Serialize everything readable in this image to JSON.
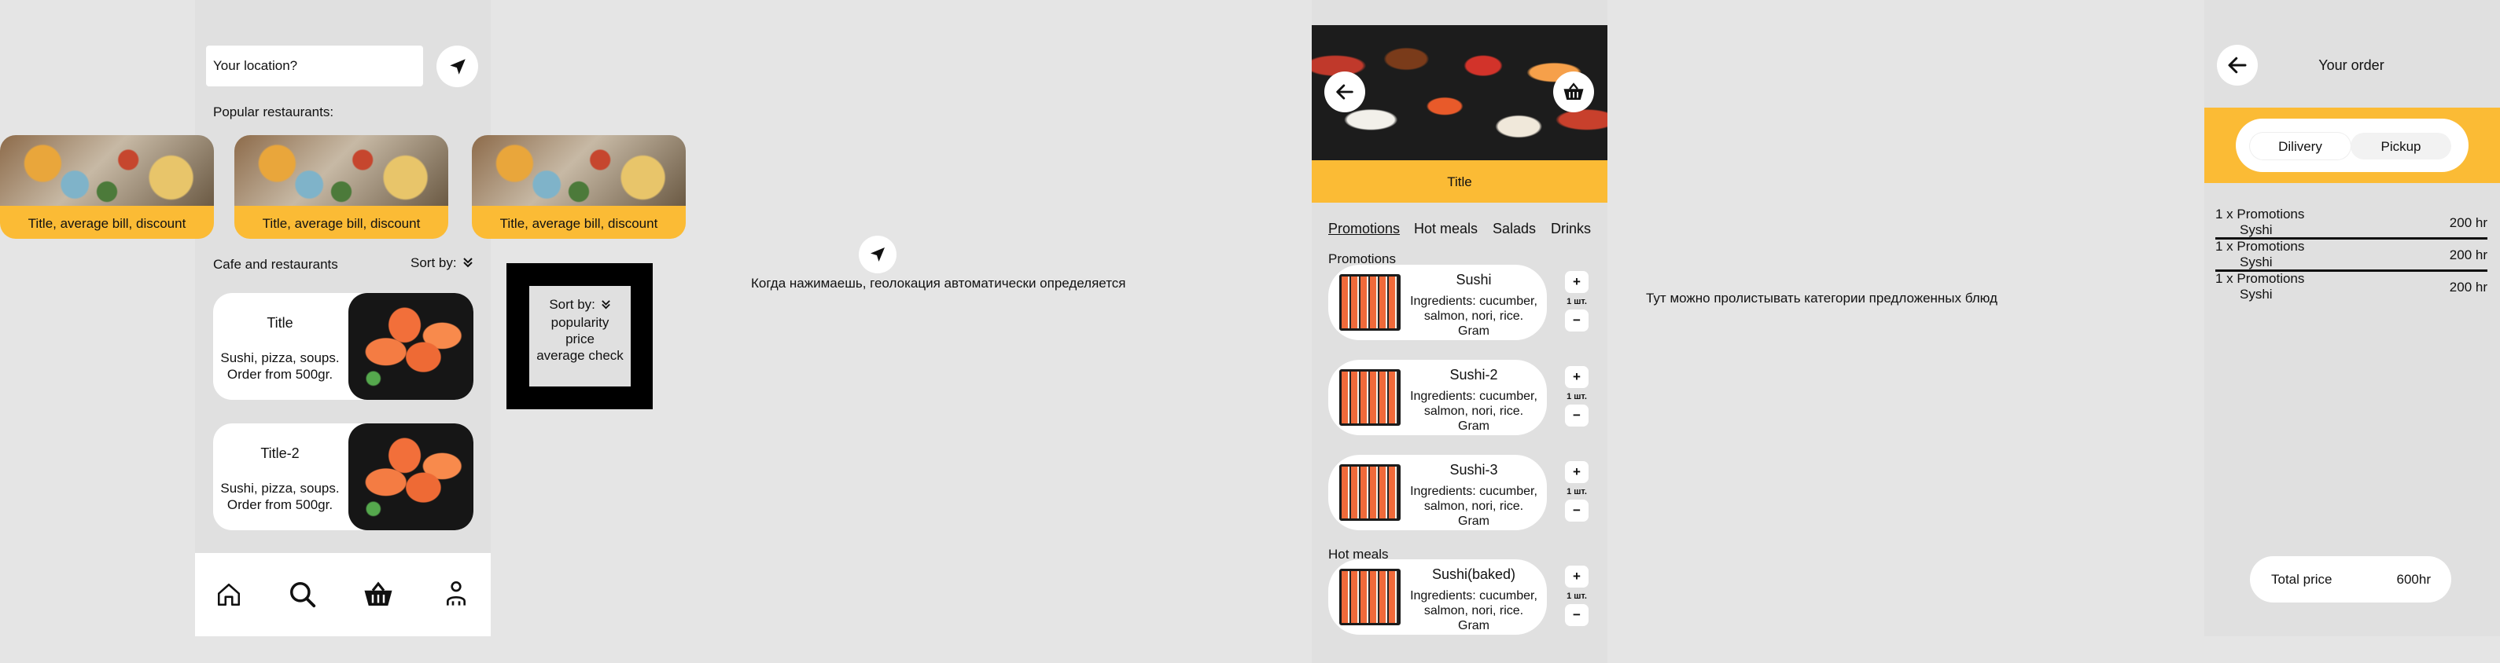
{
  "screen1": {
    "location_placeholder": "Your location?",
    "popular_label": "Popular restaurants:",
    "popular_cards": [
      {
        "caption": "Title, average bill, discount"
      },
      {
        "caption": "Title, average bill, discount"
      },
      {
        "caption": "Title, average bill, discount"
      }
    ],
    "cafes_label": "Cafe and restaurants",
    "sort_label": "Sort by:",
    "restaurants": [
      {
        "title": "Title",
        "desc": "Sushi, pizza, soups.\nOrder from 500gr."
      },
      {
        "title": "Title-2",
        "desc": "Sushi, pizza, soups.\nOrder from 500gr."
      }
    ],
    "nav": [
      "home-icon",
      "search-icon",
      "basket-icon",
      "profile-icon"
    ]
  },
  "sort_popup": {
    "title": "Sort by:",
    "options": [
      "popularity",
      "price",
      "average check"
    ]
  },
  "note_geo": "Когда нажимаешь, геолокация автоматически определяется",
  "screen2": {
    "title": "Title",
    "tabs": [
      "Promotions",
      "Hot meals",
      "Salads",
      "Drinks"
    ],
    "sections": [
      {
        "name": "Promotions",
        "items": [
          {
            "name": "Sushi",
            "desc": "Ingredients: cucumber,\nsalmon, nori, rice.\nGram",
            "qty": "1 шт."
          },
          {
            "name": "Sushi-2",
            "desc": "Ingredients: cucumber,\nsalmon, nori, rice.\nGram",
            "qty": "1 шт."
          },
          {
            "name": "Sushi-3",
            "desc": "Ingredients: cucumber,\nsalmon, nori, rice.\nGram",
            "qty": "1 шт."
          }
        ]
      },
      {
        "name": "Hot meals",
        "items": [
          {
            "name": "Sushi(baked)",
            "desc": "Ingredients: cucumber,\nsalmon, nori, rice.\nGram",
            "qty": "1 шт."
          }
        ]
      }
    ],
    "plus": "+",
    "minus": "−"
  },
  "note_scroll": "Тут можно пролистывать категории предложенных блюд",
  "screen3": {
    "title": "Your order",
    "toggle": [
      "Dilivery",
      "Pickup"
    ],
    "order_lines": [
      {
        "line1": "1 x Promotions",
        "line2": "Syshi",
        "price": "200 hr"
      },
      {
        "line1": "1 x Promotions",
        "line2": "Syshi",
        "price": "200 hr"
      },
      {
        "line1": "1 x Promotions",
        "line2": "Syshi",
        "price": "200 hr"
      }
    ],
    "total_label": "Total price",
    "total_value": "600hr"
  },
  "colors": {
    "accent": "#fbbb35",
    "background": "#e5e5e5",
    "popup": "#000000"
  }
}
